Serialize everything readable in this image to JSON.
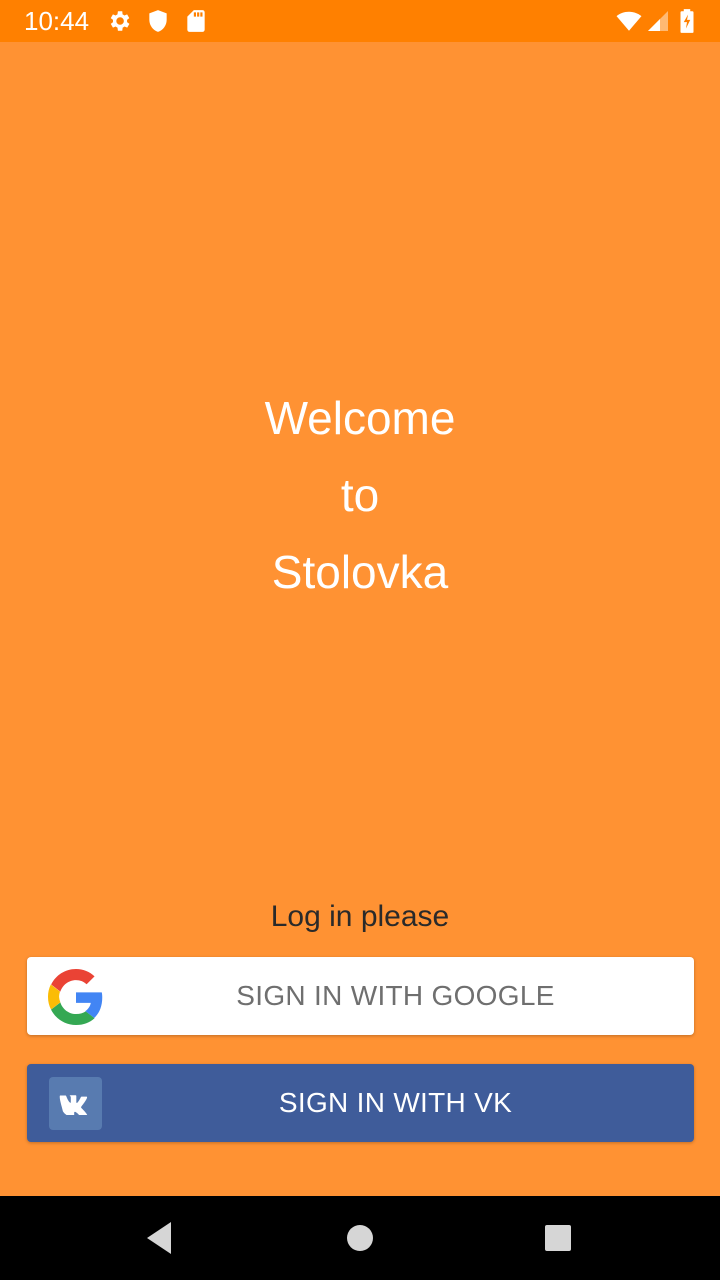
{
  "status_bar": {
    "time": "10:44",
    "icons": [
      "gear-icon",
      "shield-icon",
      "sd-card-icon",
      "wifi-icon",
      "signal-icon",
      "battery-icon"
    ]
  },
  "welcome": {
    "line1": "Welcome",
    "line2": "to",
    "line3": "Stolovka"
  },
  "login": {
    "hint": "Log in please",
    "google_label": "SIGN IN WITH GOOGLE",
    "vk_label": "SIGN IN WITH VK"
  },
  "nav": {
    "icons": [
      "back-icon",
      "home-icon",
      "recents-icon"
    ]
  },
  "colors": {
    "background": "#FF9233",
    "status_bar": "#FF8000",
    "vk_button": "#3F5C9A",
    "google_button": "#FFFFFF"
  }
}
